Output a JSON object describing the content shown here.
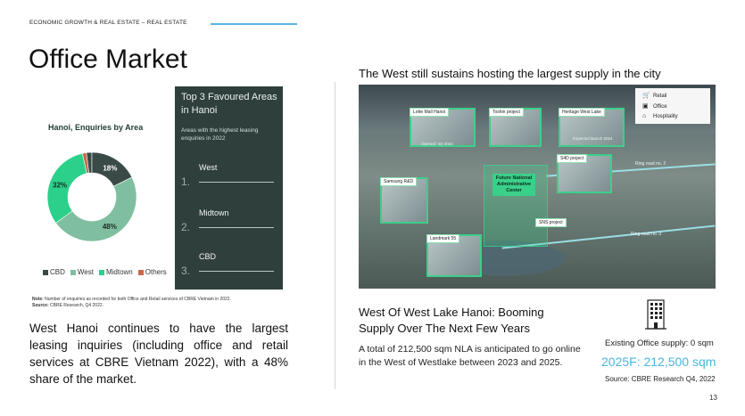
{
  "header": {
    "section_label": "ECONOMIC GROWTH & REAL ESTATE – REAL ESTATE"
  },
  "page_title": "Office Market",
  "donut": {
    "title": "Hanoi, Enquiries by Area",
    "segments": [
      {
        "name": "CBD",
        "value": 2,
        "label": "",
        "color": "#3a4a47"
      },
      {
        "name": "West",
        "value": 48,
        "label": "48%",
        "color": "#7fbf9f"
      },
      {
        "name": "Midtown",
        "value": 32,
        "label": "32%",
        "color": "#2bd08a"
      },
      {
        "name": "Others",
        "value": 18,
        "label": "18%",
        "color": "#3a4a47"
      },
      {
        "name": "Others-small",
        "value": 1.5,
        "label": "",
        "color": "#c8684c"
      }
    ],
    "legend": [
      {
        "label": "CBD",
        "color": "#3a4a47"
      },
      {
        "label": "West",
        "color": "#7fbf9f"
      },
      {
        "label": "Midtown",
        "color": "#2bd08a"
      },
      {
        "label": "Others",
        "color": "#c8684c"
      }
    ]
  },
  "favoured": {
    "title": "Top 3 Favoured Areas in Hanoi",
    "subtitle": "Areas with the highest leasing enquiries in 2022",
    "items": [
      {
        "num": "1.",
        "label": "West"
      },
      {
        "num": "2.",
        "label": "Midtown"
      },
      {
        "num": "3.",
        "label": "CBD"
      }
    ]
  },
  "note": {
    "note_label": "Note:",
    "note_text": " Number of enquiries as recorded for both Office and Retail services of CBRE Vietnam in 2022.",
    "source_label": "Source:",
    "source_text": " CBRE Research, Q4 2022."
  },
  "body_left": "West Hanoi continues to have the largest leasing inquiries (including office and retail services at CBRE Vietnam 2022), with a 48% share of the market.",
  "right_heading": "The West still sustains hosting the largest supply in the city",
  "map": {
    "legend": [
      {
        "icon": "cart-icon",
        "glyph": "🛒",
        "label": "Retail"
      },
      {
        "icon": "office-icon",
        "glyph": "▣",
        "label": "Office"
      },
      {
        "icon": "hospitality-icon",
        "glyph": "⌂",
        "label": "Hospitality"
      }
    ],
    "labels": {
      "lotte": "Lotte Mall Hanoi",
      "lotte_cap": "Opened: 4Q 2022",
      "toshin": "Toshin project",
      "heritage": "Heritage West Lake",
      "heritage_cap": "Expected launch 2024",
      "samsung": "Samsung R&D",
      "s4d": "S4D project",
      "landmark": "Landmark 55",
      "sns": "SNS project",
      "future_center": "Future National Administrative Center",
      "ring2": "Ring road no. 2",
      "ring3": "Ring road no. 3"
    }
  },
  "subhead": "West Of West Lake Hanoi: Booming Supply Over The Next Few Years",
  "body_right": "A total of 212,500 sqm NLA is anticipated to go online in the West of Westlake between 2023 and 2025.",
  "stats": {
    "existing": "Existing Office supply: 0 sqm",
    "forecast": "2025F: 212,500 sqm",
    "source": "Source: CBRE Research Q4, 2022"
  },
  "page_number": "13"
}
